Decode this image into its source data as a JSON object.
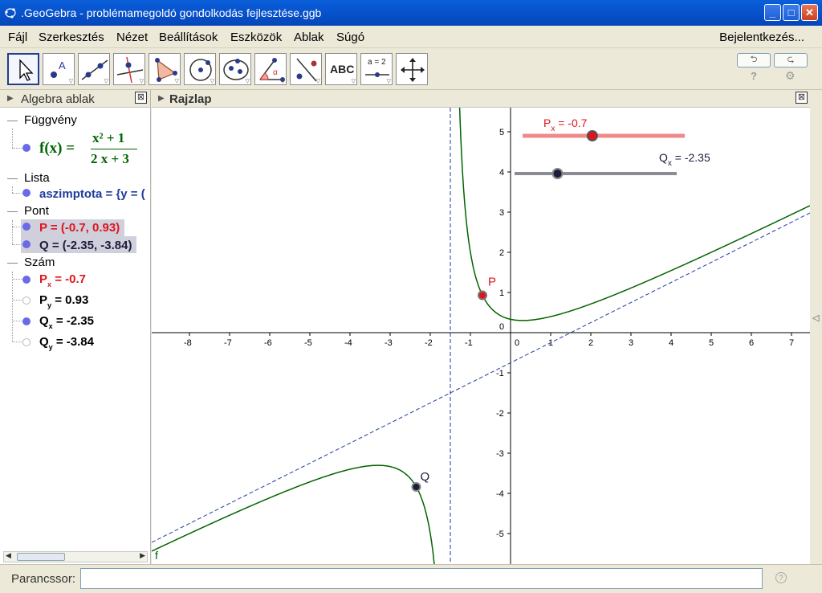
{
  "window": {
    "title": ".GeoGebra - problémamegoldó gondolkodás fejlesztése.ggb"
  },
  "menu": {
    "items": [
      "Fájl",
      "Szerkesztés",
      "Nézet",
      "Beállítások",
      "Eszközök",
      "Ablak",
      "Súgó"
    ],
    "login": "Bejelentkezés..."
  },
  "toolbar": {
    "tools": [
      "move-tool",
      "point-tool",
      "line-tool",
      "perpendicular-tool",
      "polygon-tool",
      "circle-tool",
      "conic-tool",
      "angle-tool",
      "reflect-tool",
      "text-tool",
      "slider-tool",
      "move-view-tool"
    ],
    "text_tool_label": "ABC",
    "slider_tool_label": "a = 2",
    "help_symbol": "?",
    "undo_symbol": "⮌",
    "redo_symbol": "⮎"
  },
  "algebra": {
    "title": "Algebra ablak",
    "categories": {
      "function": "Függvény",
      "list": "Lista",
      "point": "Pont",
      "number": "Szám"
    },
    "function": {
      "name": "f(x) =",
      "numerator": "x² + 1",
      "denominator": "2 x + 3"
    },
    "list_item": "aszimptota = {y = (",
    "points": [
      "P = (-0.7, 0.93)",
      "Q = (-2.35, -3.84)"
    ],
    "numbers": [
      {
        "base": "P",
        "sub": "x",
        "rest": " = -0.7"
      },
      {
        "base": "P",
        "sub": "y",
        "rest": " = 0.93"
      },
      {
        "base": "Q",
        "sub": "x",
        "rest": " = -2.35"
      },
      {
        "base": "Q",
        "sub": "y",
        "rest": " = -3.84"
      }
    ]
  },
  "graphics": {
    "title": "Rajzlap",
    "x_ticks": [
      "-8",
      "-7",
      "-6",
      "-5",
      "-4",
      "-3",
      "-2",
      "-1",
      "0",
      "1",
      "2",
      "3",
      "4",
      "5",
      "6",
      "7"
    ],
    "y_ticks": [
      "5",
      "4",
      "3",
      "2",
      "1",
      "0",
      "-1",
      "-2",
      "-3",
      "-4",
      "-5"
    ],
    "point_P_label": "P",
    "point_Q_label": "Q",
    "curve_label": "f",
    "slider_P": {
      "base": "P",
      "sub": "x",
      "rest": " = -0.7",
      "value": -0.7,
      "color": "#e0141e"
    },
    "slider_Q": {
      "base": "Q",
      "sub": "x",
      "rest": " = -2.35",
      "value": -2.35,
      "color": "#1c1c3c"
    },
    "P": {
      "x": -0.7,
      "y": 0.93
    },
    "Q": {
      "x": -2.35,
      "y": -3.84
    },
    "asymptote_vertical_x": -1.5,
    "asymptote_oblique": {
      "slope": 0.5,
      "intercept": -0.75
    }
  },
  "input": {
    "label": "Parancssor:",
    "value": ""
  },
  "colors": {
    "curve": "#006400",
    "asymptote": "#1f3c9c",
    "point_P": "#e0141e",
    "point_Q": "#1c1c3c"
  }
}
